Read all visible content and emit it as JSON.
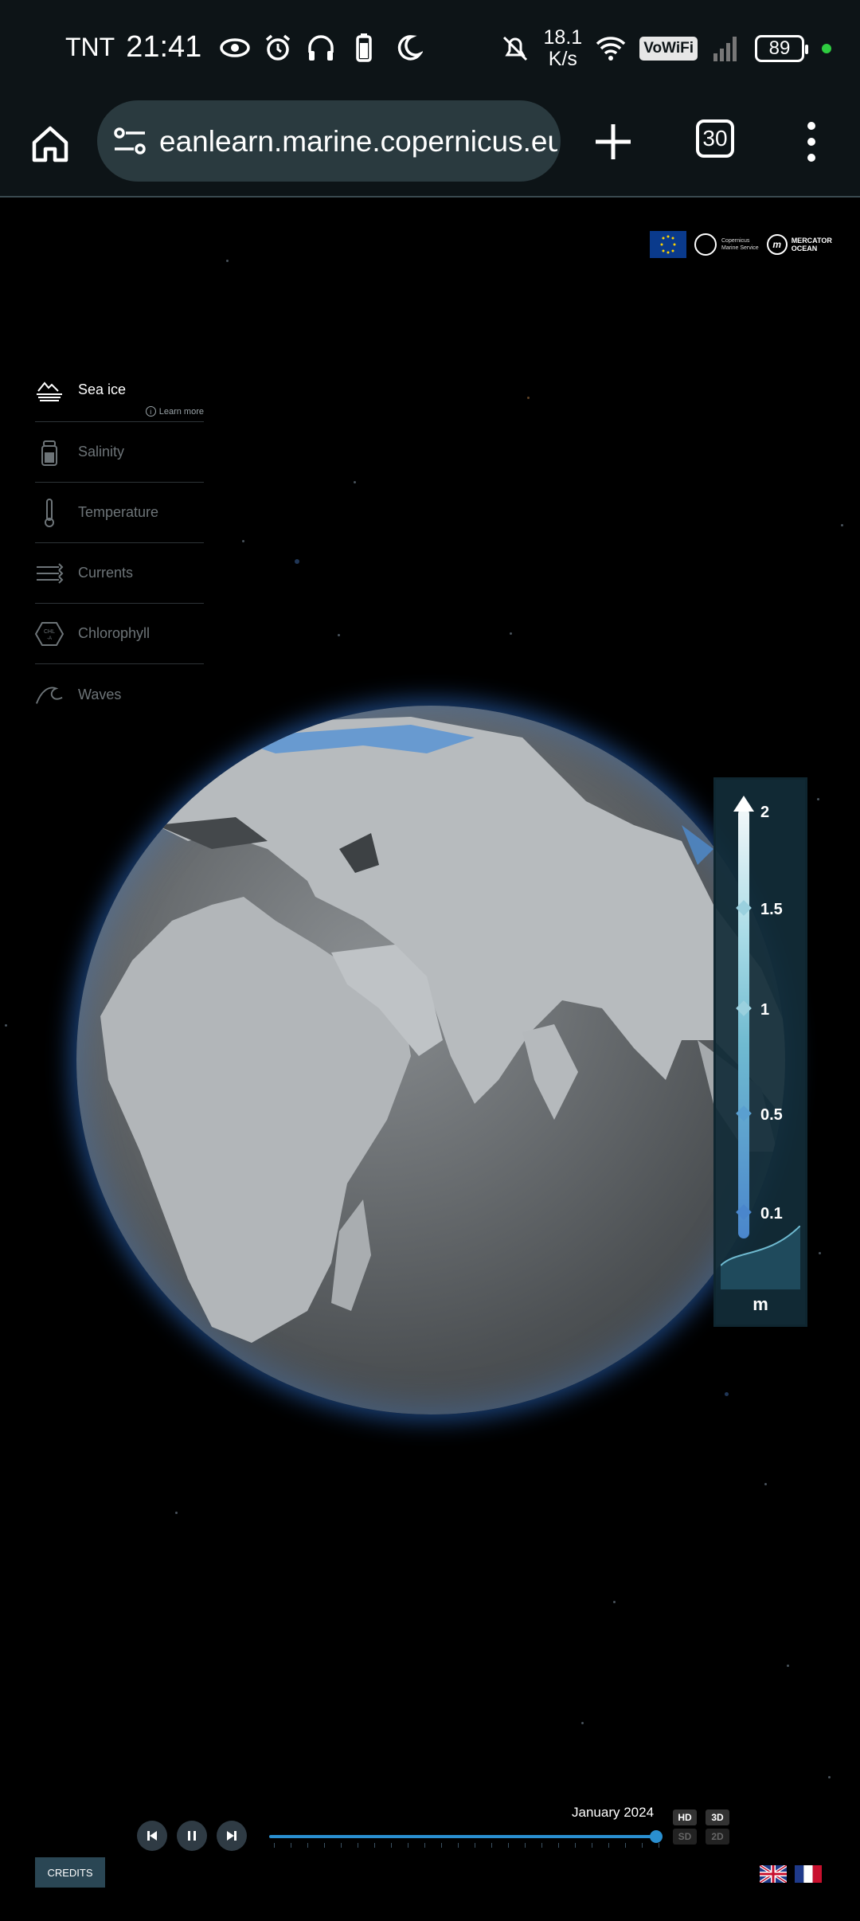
{
  "status_bar": {
    "carrier": "TNT",
    "time": "21:41",
    "speed_value": "18.1",
    "speed_unit": "K/s",
    "vowifi": "VoWiFi",
    "battery": "89",
    "icons": [
      "eye-icon",
      "alarm-icon",
      "headphones-icon",
      "battery-saver-icon",
      "moon-icon",
      "mute-icon",
      "wifi-icon",
      "signal-icon"
    ]
  },
  "browser": {
    "url": "eanlearn.marine.copernicus.eu",
    "tab_count": "30"
  },
  "header": {
    "logos": {
      "cms_line1": "Copernicus",
      "cms_line2": "Marine Service",
      "mo_line1": "MERCATOR",
      "mo_line2": "OCEAN"
    }
  },
  "sidebar": {
    "items": [
      {
        "label": "Sea ice",
        "icon": "sea-ice-icon",
        "active": true
      },
      {
        "label": "Salinity",
        "icon": "salinity-icon",
        "active": false
      },
      {
        "label": "Temperature",
        "icon": "thermometer-icon",
        "active": false
      },
      {
        "label": "Currents",
        "icon": "currents-icon",
        "active": false
      },
      {
        "label": "Chlorophyll",
        "icon": "chlorophyll-icon",
        "active": false
      },
      {
        "label": "Waves",
        "icon": "waves-icon",
        "active": false
      }
    ],
    "learn_more": "Learn more"
  },
  "legend": {
    "values": [
      "2",
      "1.5",
      "1",
      "0.5",
      "0.1"
    ],
    "unit": "m",
    "colors": [
      "#f2f7f9",
      "#a8dbe6",
      "#6fbad0",
      "#5a9fd0",
      "#4a86cc"
    ]
  },
  "timeline": {
    "date": "January 2024",
    "modes": {
      "hd": "HD",
      "sd": "SD",
      "three_d": "3D",
      "two_d": "2D"
    },
    "progress": 1.0
  },
  "footer": {
    "credits": "CREDITS"
  },
  "colors": {
    "accent": "#2a8fd0",
    "page_bg": "#000000",
    "bar_bg": "#0d1417"
  }
}
